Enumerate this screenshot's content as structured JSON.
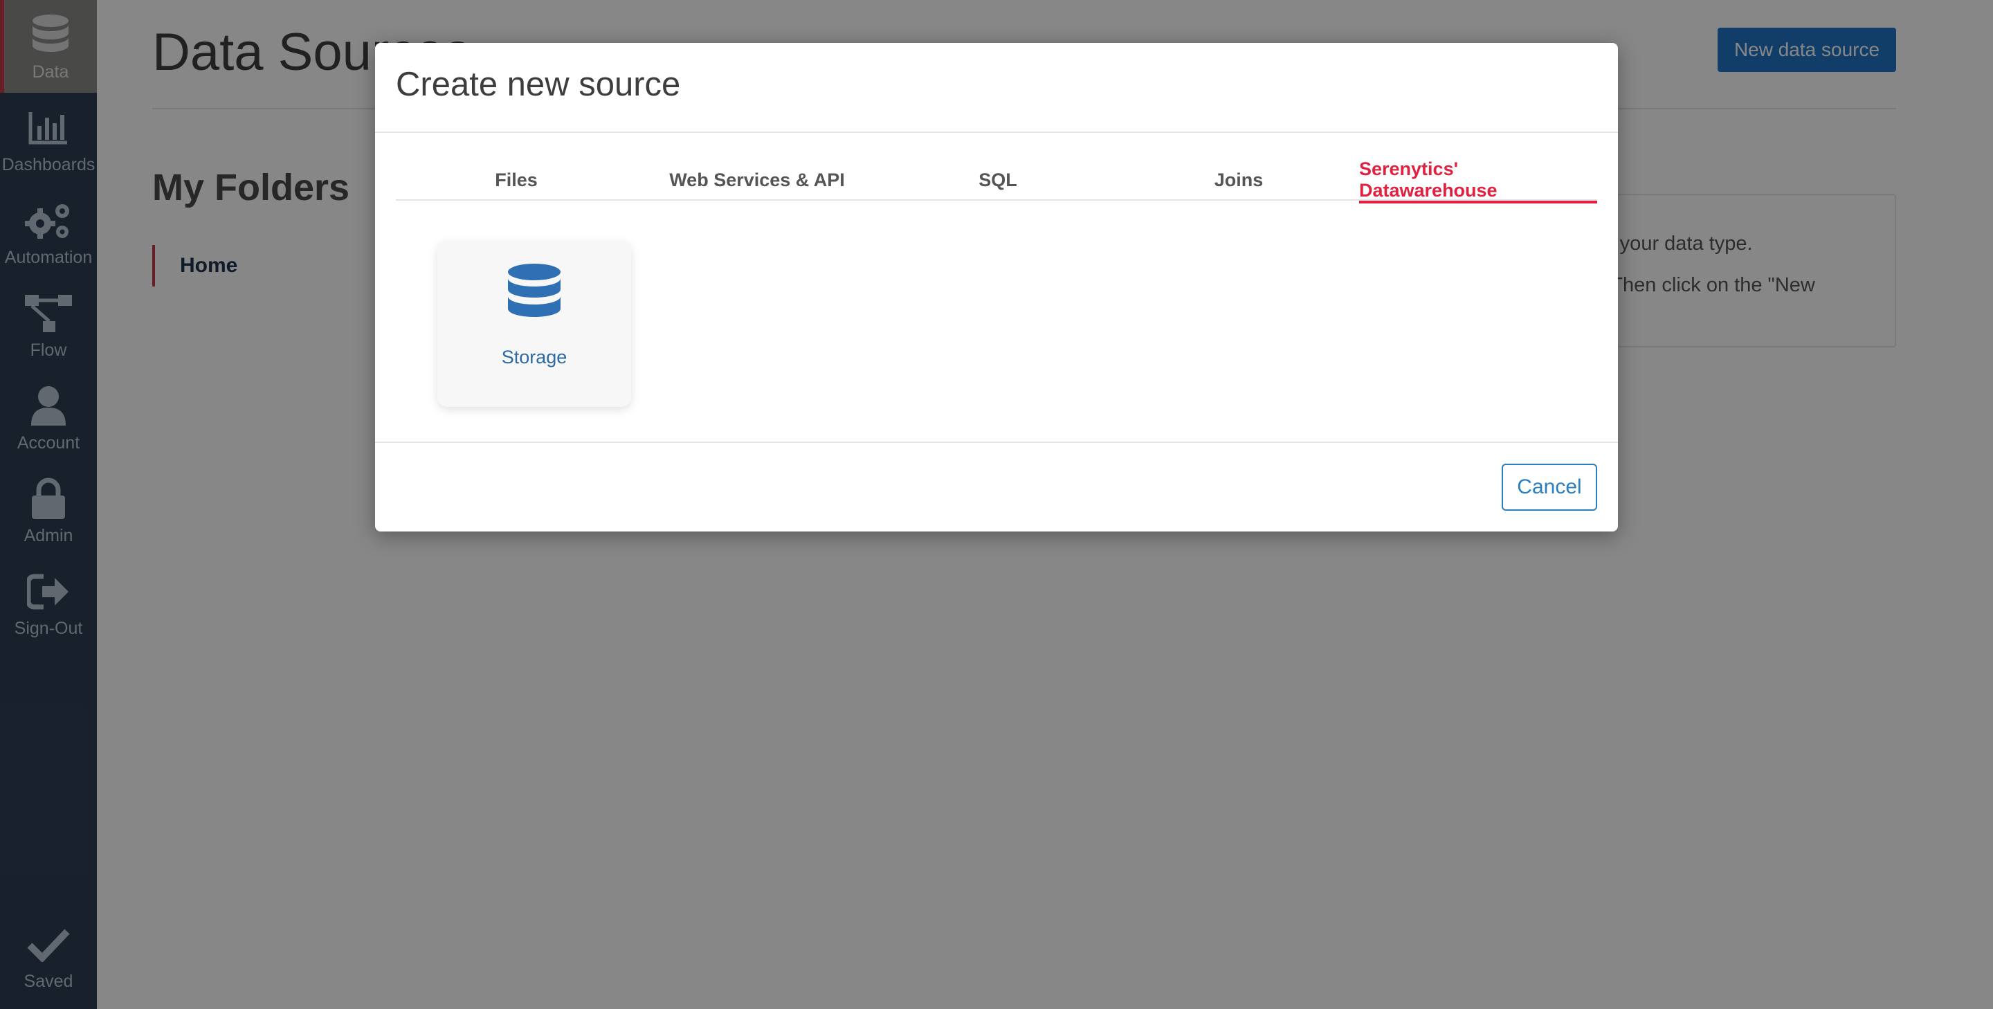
{
  "sidebar": {
    "items": [
      {
        "label": "Data",
        "icon": "database-icon",
        "active": true
      },
      {
        "label": "Dashboards",
        "icon": "bar-chart-icon"
      },
      {
        "label": "Automation",
        "icon": "gears-icon"
      },
      {
        "label": "Flow",
        "icon": "flow-icon"
      },
      {
        "label": "Account",
        "icon": "user-icon"
      },
      {
        "label": "Admin",
        "icon": "lock-icon"
      },
      {
        "label": "Sign-Out",
        "icon": "sign-out-icon"
      }
    ],
    "saved_label": "Saved"
  },
  "main": {
    "page_title": "Data Sources",
    "new_source_label": "New data source",
    "folders_title": "My Folders",
    "folder_home": "Home",
    "help_line_1": "se your data type.",
    "help_line_2": "). Then click on the \"New"
  },
  "modal": {
    "title": "Create new source",
    "tabs": [
      {
        "label": "Files"
      },
      {
        "label": "Web Services & API"
      },
      {
        "label": "SQL"
      },
      {
        "label": "Joins"
      },
      {
        "label": "Serenytics' Datawarehouse",
        "active": true
      }
    ],
    "card": {
      "label": "Storage",
      "icon": "database-icon"
    },
    "cancel_label": "Cancel"
  },
  "colors": {
    "sidebar_bg": "#2f3e53",
    "accent_red": "#e0213f",
    "primary_blue": "#1f75c6"
  }
}
